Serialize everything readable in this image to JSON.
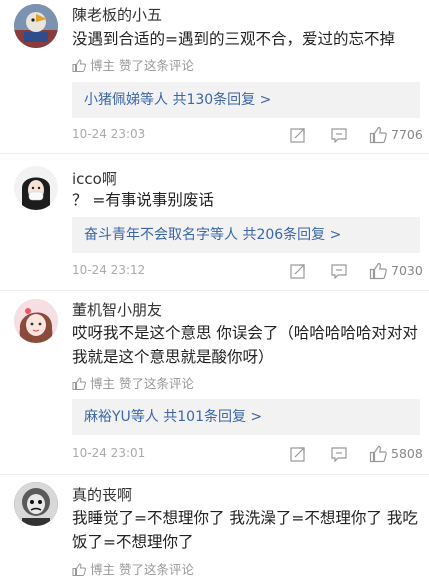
{
  "comments": [
    {
      "username": "陳老板的小五",
      "text": "没遇到合适的=遇到的三观不合，爱过的忘不掉",
      "liked_by": "博主",
      "liked_suffix": "赞了这条评论",
      "reply_who": "小猪佩娣",
      "reply_rest": "等人 共130条回复 >",
      "time": "10-24 23:03",
      "likes": "7706"
    },
    {
      "username": "icco啊",
      "text": "？ =有事说事别废话",
      "reply_who": "奋斗青年不会取名字",
      "reply_rest": "等人 共206条回复 >",
      "time": "10-24 23:12",
      "likes": "7030"
    },
    {
      "username": "董机智小朋友",
      "text": "哎呀我不是这个意思 你误会了（哈哈哈哈哈对对对我就是这个意思就是酸你呀）",
      "liked_by": "博主",
      "liked_suffix": "赞了这条评论",
      "reply_who": "麻裕YU",
      "reply_rest": "等人 共101条回复 >",
      "time": "10-24 23:01",
      "likes": "5808"
    },
    {
      "username": "真的丧啊",
      "text": "我睡觉了=不想理你了 我洗澡了=不想理你了 我吃饭了=不想理你了",
      "liked_by": "博主",
      "liked_suffix": "赞了这条评论"
    }
  ],
  "colors": {
    "link": "#3c66a8",
    "muted": "#999999",
    "reply_bg": "#f2f2f2"
  },
  "icons": [
    "thumb-up-icon",
    "share-icon",
    "comment-icon",
    "like-icon"
  ]
}
